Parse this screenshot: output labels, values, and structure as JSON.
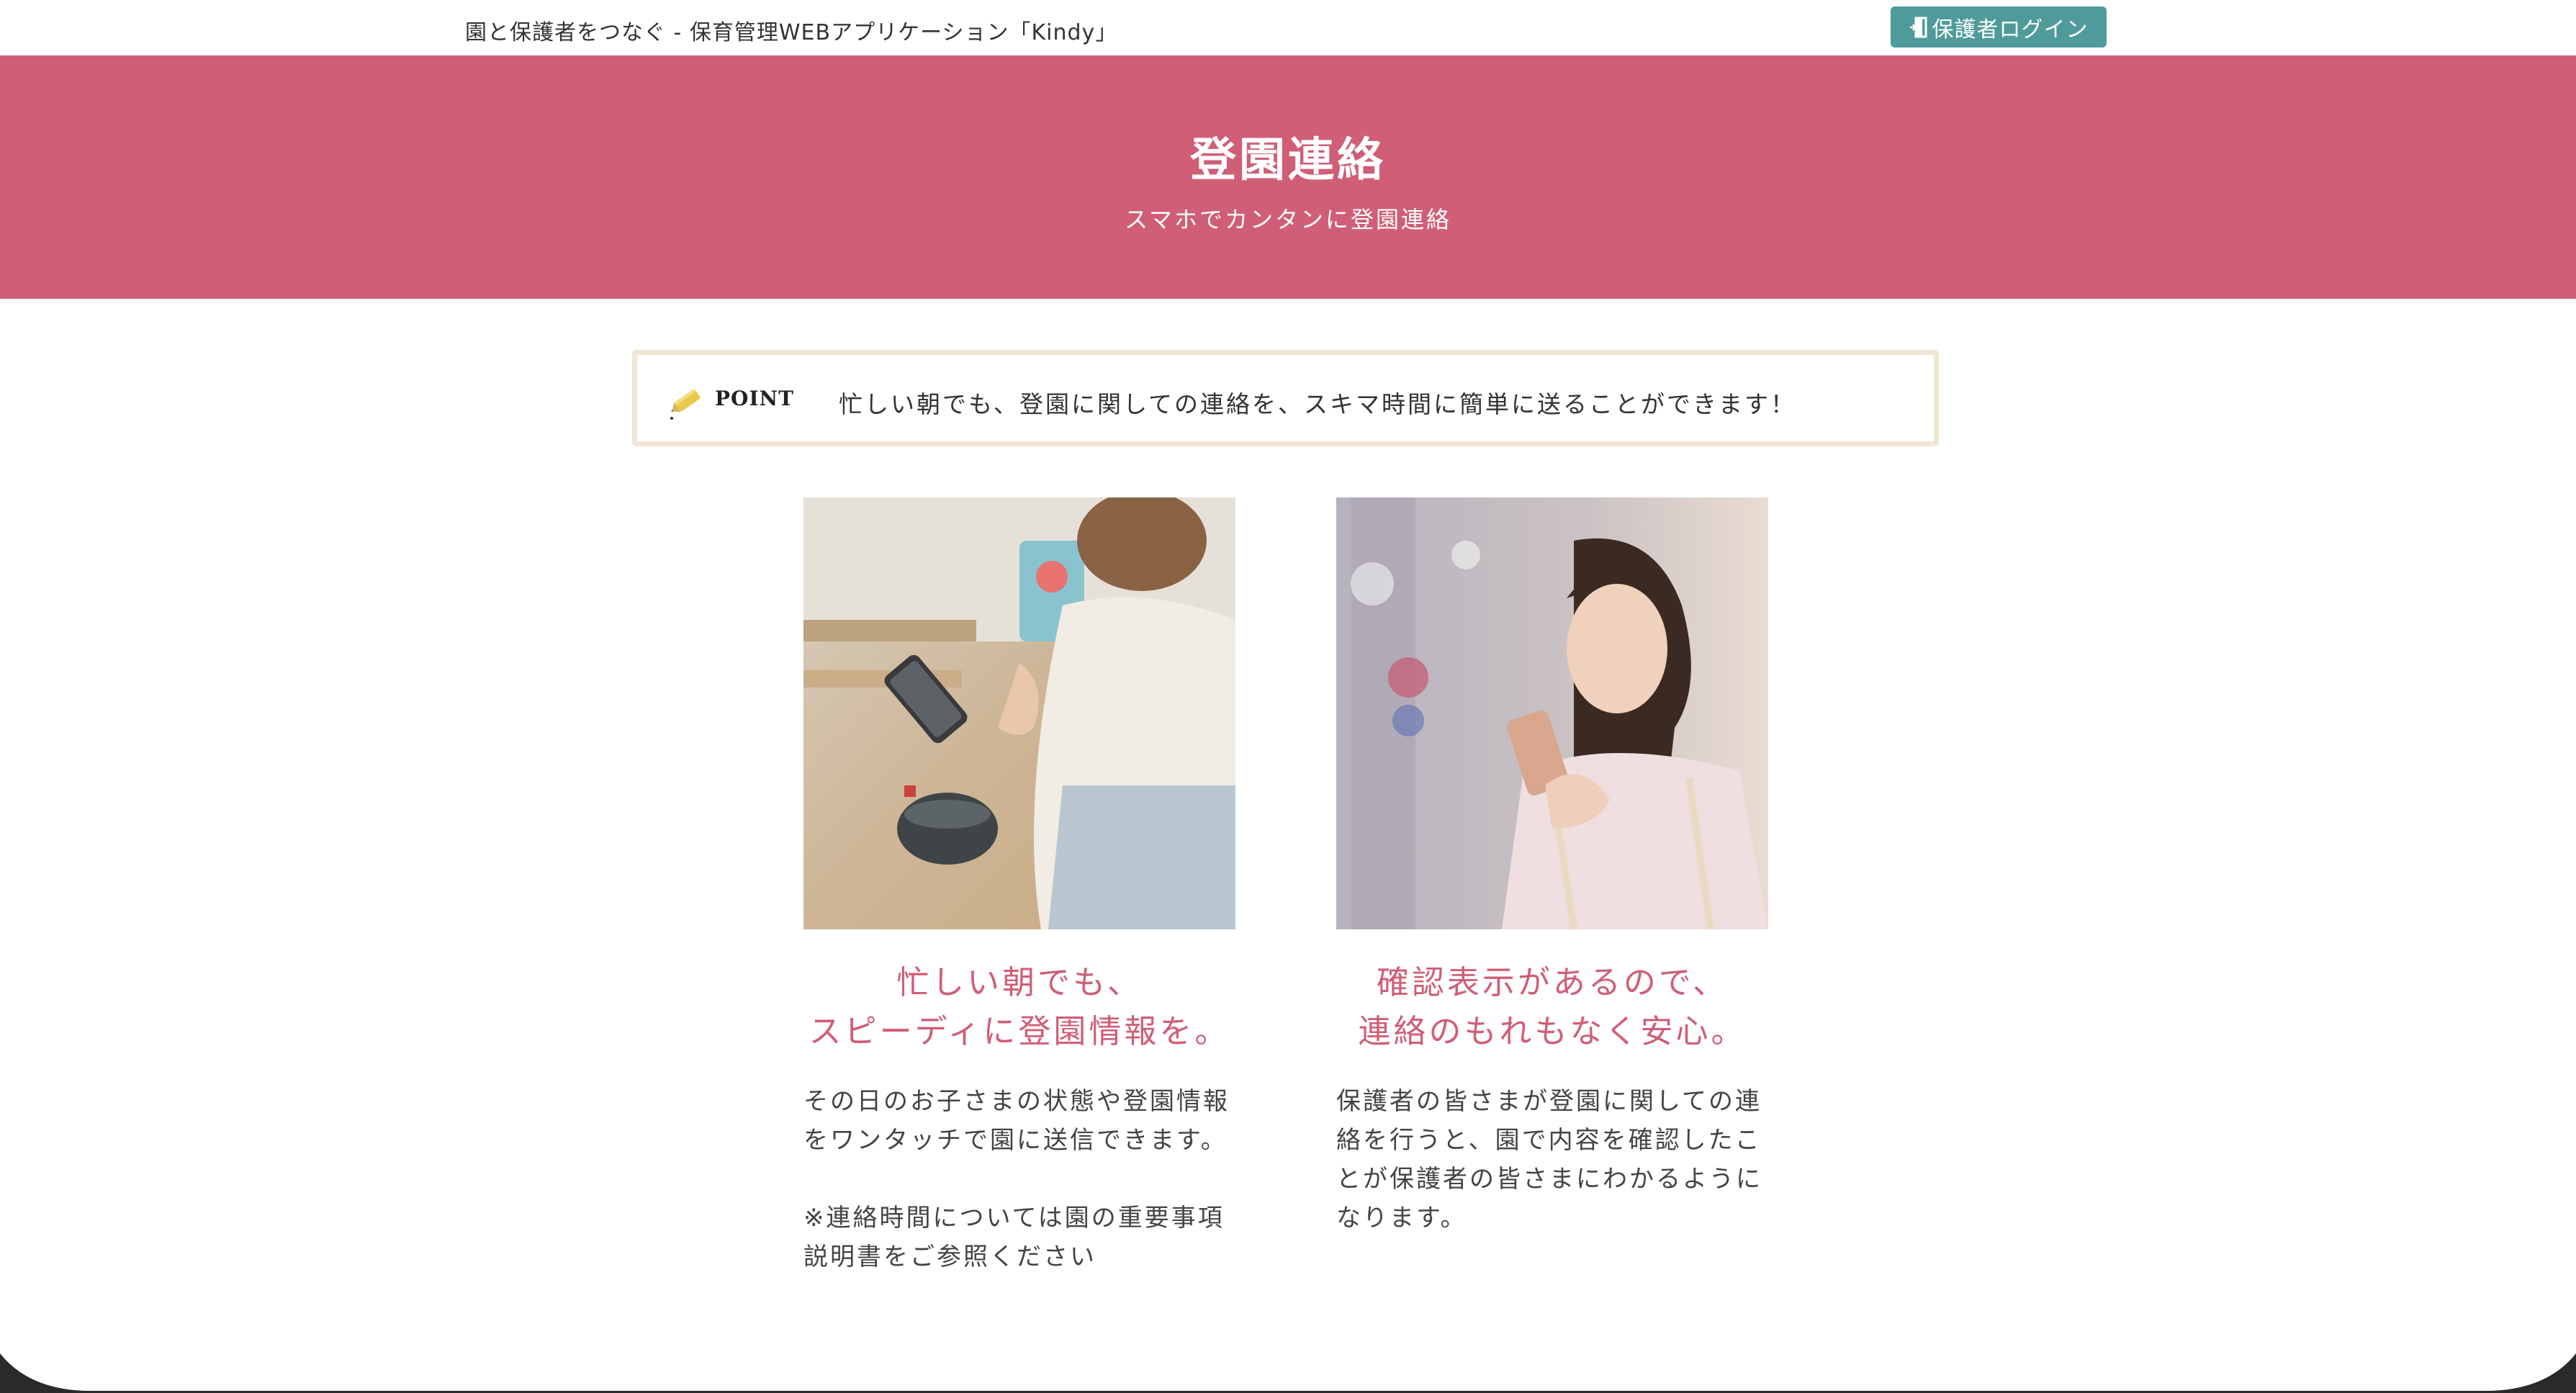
{
  "header": {
    "tagline": "園と保護者をつなぐ - 保育管理WEBアプリケーション「Kindy」",
    "login_label": "保護者ログイン",
    "login_icon": "door-exit-icon"
  },
  "hero": {
    "title": "登園連絡",
    "subtitle": "スマホでカンタンに登園連絡"
  },
  "point": {
    "label": "POINT",
    "icon": "pencil-icon",
    "text": "忙しい朝でも、登園に関しての連絡を、スキマ時間に簡単に送ることができます！"
  },
  "cards": [
    {
      "image": "woman-using-smartphone-indoors-photo",
      "heading_line1": "忙しい朝でも、",
      "heading_line2": "スピーディに登園情報を。",
      "body_p1": "その日のお子さまの状態や登園情報をワンタッチで園に送信できます。",
      "body_p2": "※連絡時間については園の重要事項説明書をご参照ください"
    },
    {
      "image": "woman-smiling-at-smartphone-street-photo",
      "heading_line1": "確認表示があるので、",
      "heading_line2": "連絡のもれもなく安心。",
      "body_p1": "保護者の皆さまが登園に関しての連絡を行うと、園で内容を確認したことが保護者の皆さまにわかるようになります。"
    }
  ],
  "colors": {
    "accent_pink": "#d05e76",
    "button_teal": "#4f9a9a",
    "point_border": "#efe6d4"
  }
}
